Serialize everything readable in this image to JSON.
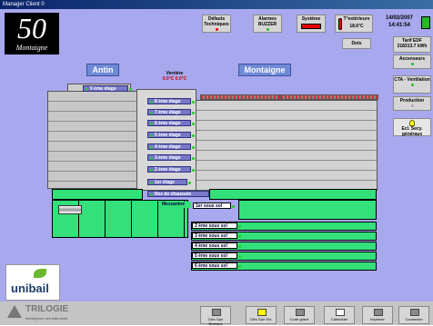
{
  "window": {
    "title": "Manager Client 0"
  },
  "brand": {
    "number": "50",
    "name": "Montaigne"
  },
  "buildings": {
    "left": "Antin",
    "right": "Montaigne"
  },
  "verrière": {
    "label": "Verrière",
    "values": "0.0°C  0.0°C"
  },
  "top_buttons": {
    "defauts": "Défauts Techniques",
    "alarmes": "Alarmes BUZZER",
    "systeme": "Système",
    "temp_label": "T°extérieure",
    "temp_value": "18.6°C",
    "date": "14/02/2007",
    "time": "14:41:54",
    "dots": "Dots"
  },
  "right_panel": {
    "tarif_label": "Tarif EDF",
    "tarif_value": "218313.7 kWh",
    "ascenseurs": "Ascenseurs",
    "cta": "CTA - Ventilation",
    "production": "Production",
    "eclairage": "Ecl. Secy. généraux"
  },
  "floors_top": [
    "9 ème étage",
    "8 ème étage",
    "7 ème étage",
    "6 ème étage",
    "5 ème étage",
    "4 ème étage",
    "3 ème étage",
    "2 ème étage",
    "1er étage",
    "Rez de chaussée"
  ],
  "mezzanine": "Mezzanine",
  "sous_sols": [
    "1er sous sol",
    "2 ème sous sol",
    "3 ème sous sol",
    "4 ème sous sol",
    "5 ème sous sol",
    "6 ème sous sol"
  ],
  "left_logo": {
    "name": "unibail"
  },
  "footer": {
    "trilogie": "TRILOGIE",
    "trilogie_sub": "Intelligence des bâtiments",
    "buttons": [
      "Clés Gpe Bureaux",
      "Clés Gpe Ext.",
      "Code grâce",
      "Calendrier",
      "Imprimer",
      "Connexion"
    ]
  },
  "colors": {
    "background": "#a8a8ee",
    "green_zone": "#33e07a",
    "floor_label": "#7878c8"
  }
}
